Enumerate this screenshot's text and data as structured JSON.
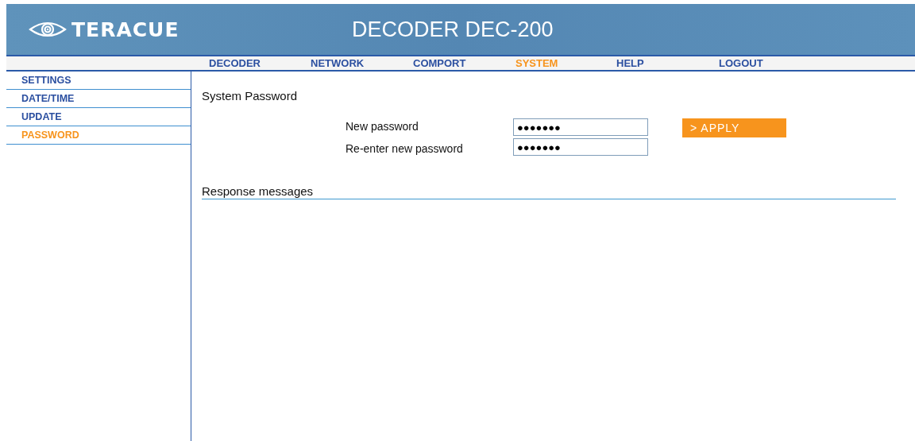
{
  "header": {
    "logo_text": "TERACUE",
    "title": "DECODER DEC-200"
  },
  "nav": [
    {
      "label": "DECODER",
      "selected": false
    },
    {
      "label": "NETWORK",
      "selected": false
    },
    {
      "label": "COMPORT",
      "selected": false
    },
    {
      "label": "SYSTEM",
      "selected": true
    },
    {
      "label": "HELP",
      "selected": false
    },
    {
      "label": "LOGOUT",
      "selected": false
    }
  ],
  "sidebar": {
    "items": [
      {
        "label": "SETTINGS",
        "selected": false
      },
      {
        "label": "DATE/TIME",
        "selected": false
      },
      {
        "label": "UPDATE",
        "selected": false
      },
      {
        "label": "PASSWORD",
        "selected": true
      }
    ]
  },
  "section_title": "System Password",
  "fields": [
    {
      "label": "New password",
      "value": "●●●●●●●"
    },
    {
      "label": "Re-enter new password",
      "value": "●●●●●●●"
    }
  ],
  "apply_button": "> APPLY",
  "response_title": "Response messages"
}
